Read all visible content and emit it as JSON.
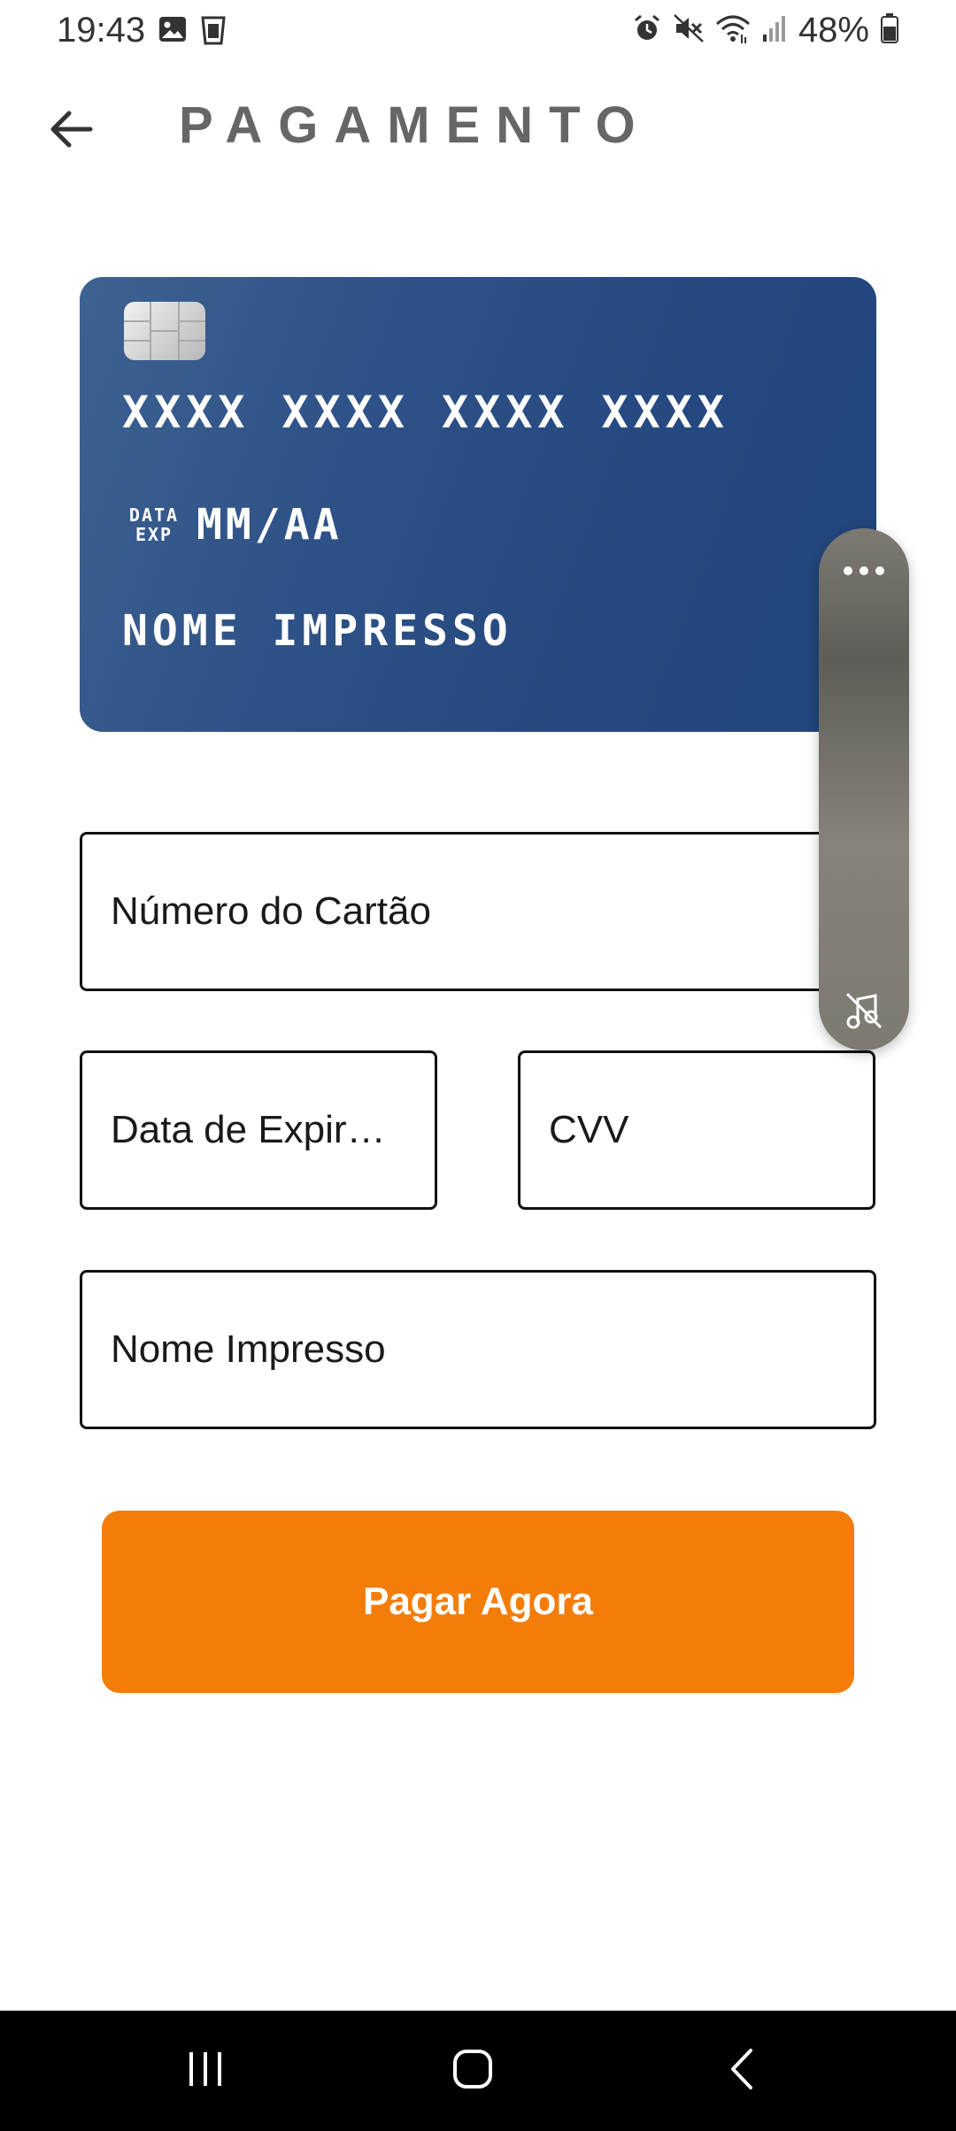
{
  "status_bar": {
    "time": "19:43",
    "battery": "48%",
    "left_icons": [
      "image-icon",
      "trash-can-icon"
    ],
    "right_icons": [
      "alarm-icon",
      "mute-icon",
      "wifi-icon",
      "signal-icon",
      "battery-icon"
    ]
  },
  "header": {
    "title": "PAGAMENTO",
    "back_icon": "arrow-left-icon"
  },
  "card": {
    "number": "XXXX XXXX XXXX XXXX",
    "exp_label_line1": "DATA",
    "exp_label_line2": "EXP",
    "exp_value": "MM/AA",
    "holder": "NOME IMPRESSO",
    "color": "#2a4c82"
  },
  "form": {
    "card_number_placeholder": "Número do Cartão",
    "exp_date_placeholder": "Data de Expir…",
    "cvv_placeholder": "CVV",
    "name_placeholder": "Nome Impresso"
  },
  "pay_button": {
    "label": "Pagar Agora",
    "color": "#f47d0a"
  },
  "floating_panel": {
    "top_icon": "more-dots-icon",
    "bottom_icon": "mute-music-icon"
  },
  "nav_bar": {
    "buttons": [
      "recents-icon",
      "home-icon",
      "back-icon"
    ]
  }
}
